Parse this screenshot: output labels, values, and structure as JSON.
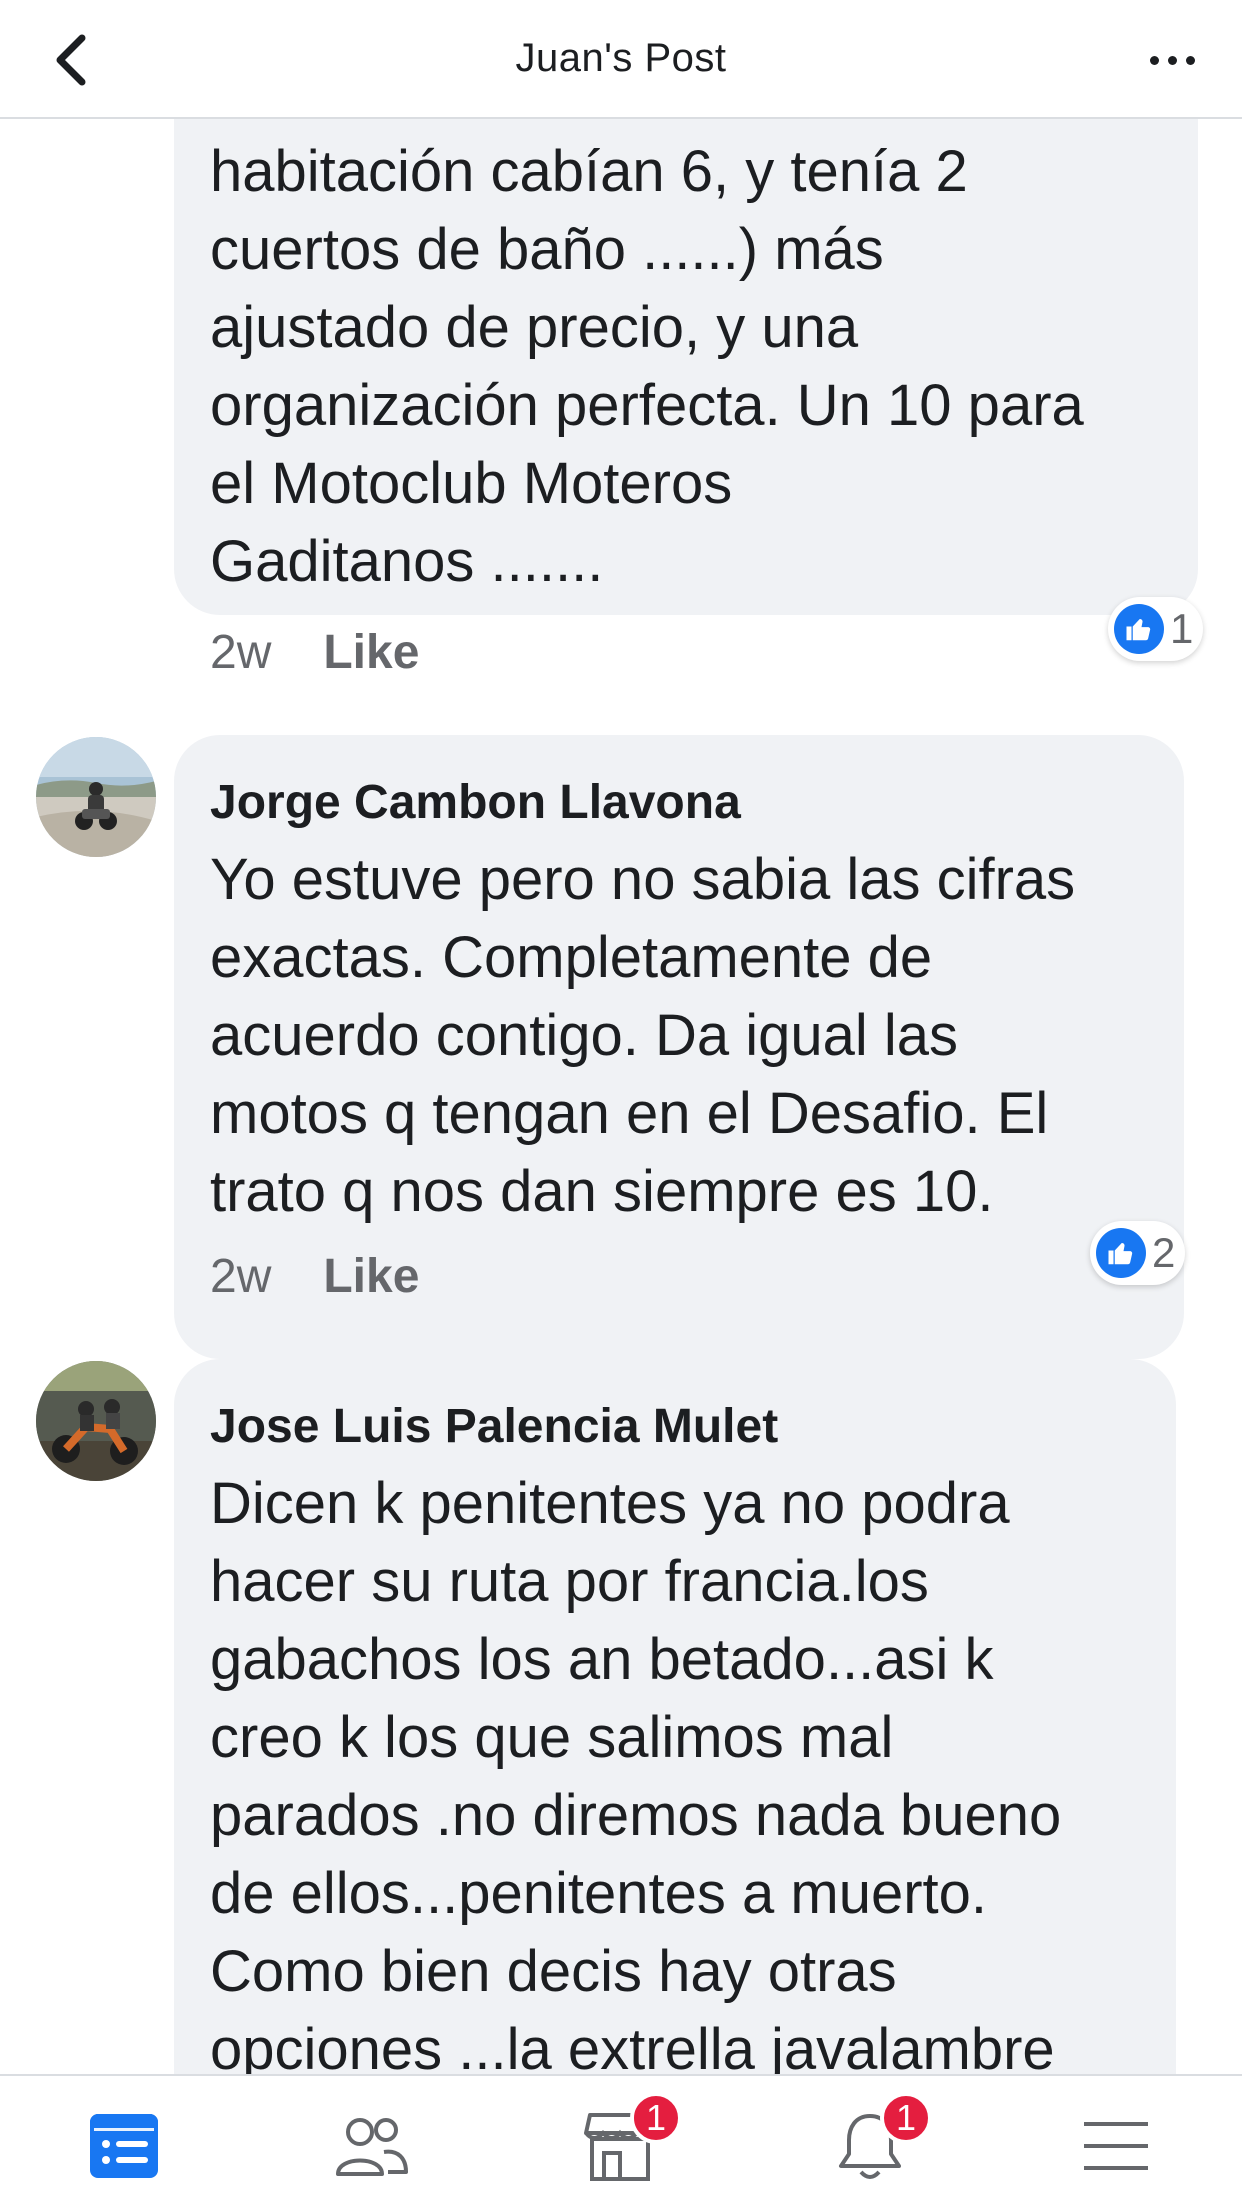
{
  "header": {
    "title": "Juan's Post"
  },
  "comments": [
    {
      "lines": [
        "habitación cabían 6, y tenía 2",
        "cuertos de baño ......) más",
        "ajustado de precio, y una",
        "organización perfecta. Un 10 para",
        "el Motoclub Moteros",
        "Gaditanos ......."
      ],
      "time": "2w",
      "like": "Like",
      "reactions": "1"
    },
    {
      "author": "Jorge Cambon Llavona",
      "lines": [
        "Yo estuve pero no sabia las cifras",
        "exactas. Completamente de",
        "acuerdo contigo. Da igual las",
        "motos q tengan en el Desafio. El",
        "trato q nos dan siempre es 10."
      ],
      "time": "2w",
      "like": "Like",
      "reactions": "2"
    },
    {
      "author": "Jose Luis Palencia Mulet",
      "lines": [
        "Dicen k penitentes ya no podra",
        "hacer su ruta por francia.los",
        "gabachos los an betado...asi k",
        "creo k los que salimos mal",
        "parados .no diremos nada bueno",
        "de ellos...penitentes a muerto.",
        "Como bien decis hay otras",
        "opciones ...la extrella javalambre"
      ]
    }
  ],
  "bottom_nav": {
    "items": [
      {
        "icon": "news-feed-icon",
        "active": true
      },
      {
        "icon": "friends-icon"
      },
      {
        "icon": "marketplace-icon",
        "badge": "1"
      },
      {
        "icon": "notifications-icon",
        "badge": "1"
      },
      {
        "icon": "menu-icon"
      }
    ]
  },
  "colors": {
    "accent": "#1877f2",
    "bubble": "#f0f2f5",
    "secondary_text": "#65676b",
    "badge": "#e41e3f"
  }
}
